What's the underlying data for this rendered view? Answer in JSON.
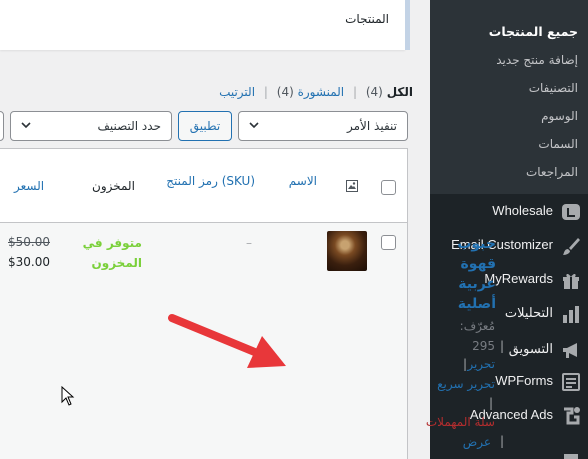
{
  "header": {
    "title": "المنتجات"
  },
  "sidebar": {
    "submenu": [
      {
        "label": "جميع المنتجات",
        "current": true
      },
      {
        "label": "إضافة منتج جديد"
      },
      {
        "label": "التصنيفات"
      },
      {
        "label": "الوسوم"
      },
      {
        "label": "السمات"
      },
      {
        "label": "المراجعات"
      }
    ],
    "menu": [
      {
        "label": "Wholesale",
        "icon": "wholesale-icon"
      },
      {
        "label": "Email Customizer",
        "icon": "brush-icon"
      },
      {
        "label": "MyRewards",
        "icon": "gift-icon"
      },
      {
        "label": "التحليلات",
        "icon": "bar-chart-icon"
      },
      {
        "label": "التسويق",
        "icon": "megaphone-icon"
      },
      {
        "label": "WPForms",
        "icon": "form-icon"
      },
      {
        "label": "Advanced Ads",
        "icon": "ads-icon"
      }
    ]
  },
  "views": {
    "all_label": "الكل",
    "all_count": "(4)",
    "published_label": "المنشورة",
    "published_count": "(4)",
    "sort_label": "الترتيب",
    "separator": "|"
  },
  "bulk": {
    "action_select": "تنفيذ الأمر",
    "apply_button": "تطبيق",
    "category_select": "حدد التصنيف"
  },
  "table": {
    "columns": {
      "name": "الاسم",
      "sku": "رمز المنتج (SKU)",
      "stock": "المخزون",
      "price": "السعر"
    },
    "row": {
      "name": "حبوب قهوة عربية أصلية",
      "sku": "–",
      "stock": "متوفر في المخزون",
      "price_old": "$50.00",
      "price_new": "$30.00",
      "id_label": "مُعرّف:",
      "id_value": "295",
      "actions": {
        "edit": "تحرير",
        "quick_edit": "تحرير سريع",
        "trash": "سلة المهملات",
        "view": "عرض"
      }
    }
  },
  "colors": {
    "sidebar_bg": "#1d2327",
    "submenu_bg": "#2c3338",
    "link": "#2271b1",
    "in_stock": "#7ad03a",
    "trash": "#b32d2e",
    "annotation_arrow": "#e8373a"
  }
}
